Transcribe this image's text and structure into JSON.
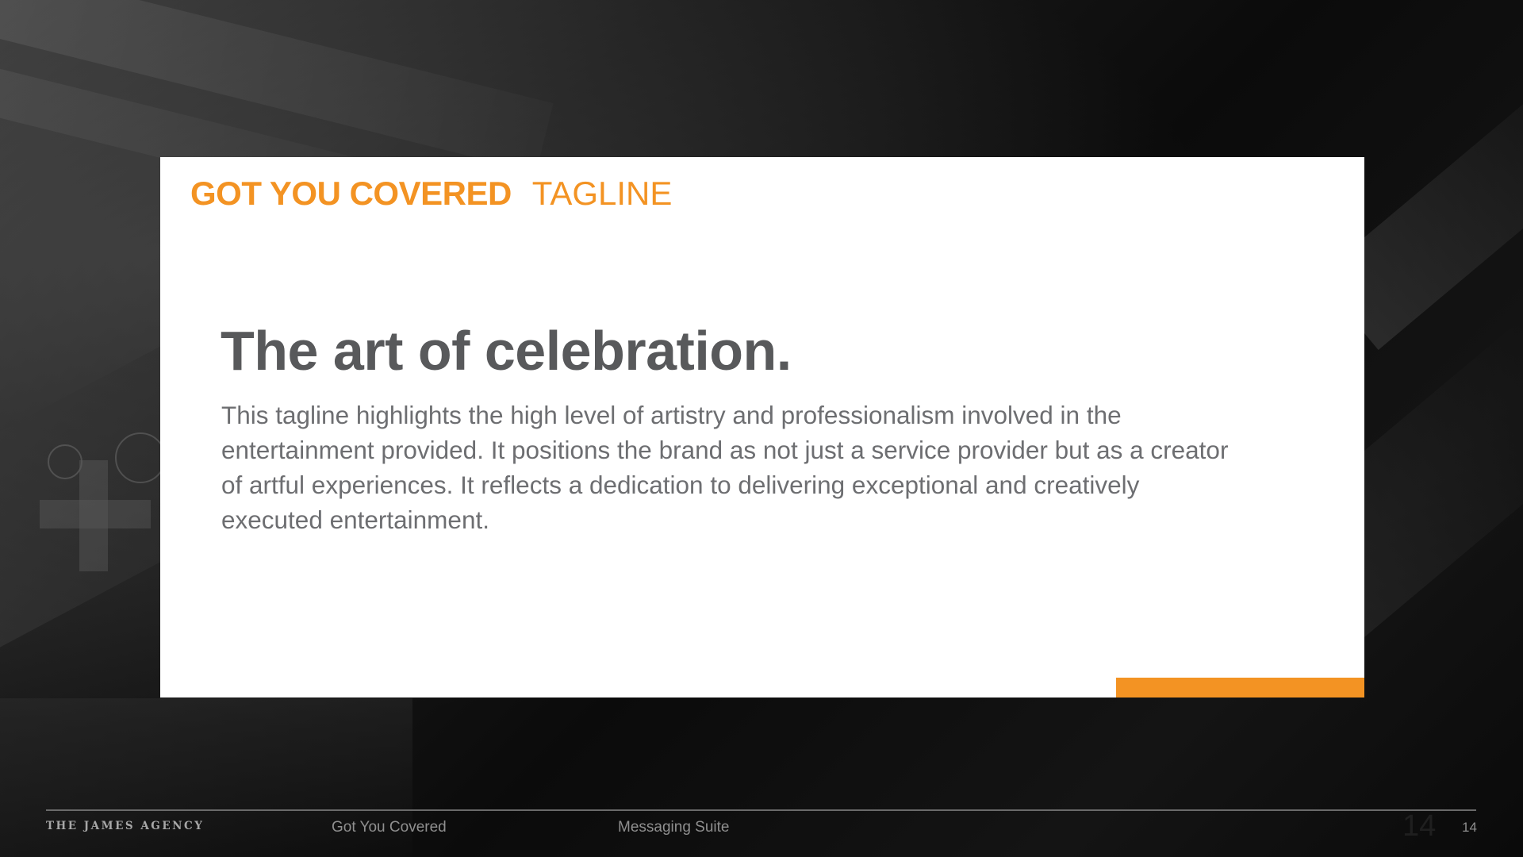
{
  "card": {
    "brand": "GOT YOU COVERED",
    "section": "TAGLINE",
    "headline": "The art of celebration.",
    "body": "This tagline highlights the high level of artistry and professionalism involved in the entertainment provided. It positions the brand as not just a service provider but as a creator of artful experiences. It reflects a dedication to delivering exceptional and creatively executed entertainment."
  },
  "footer": {
    "logo": "THE JAMES AGENCY",
    "project": "Got You Covered",
    "suite": "Messaging Suite",
    "page_ghost": "14",
    "page": "14"
  },
  "colors": {
    "accent": "#f39323",
    "headline": "#58595b",
    "body": "#6d6e71",
    "card_background": "#ffffff",
    "background": "#0d0d0d"
  }
}
